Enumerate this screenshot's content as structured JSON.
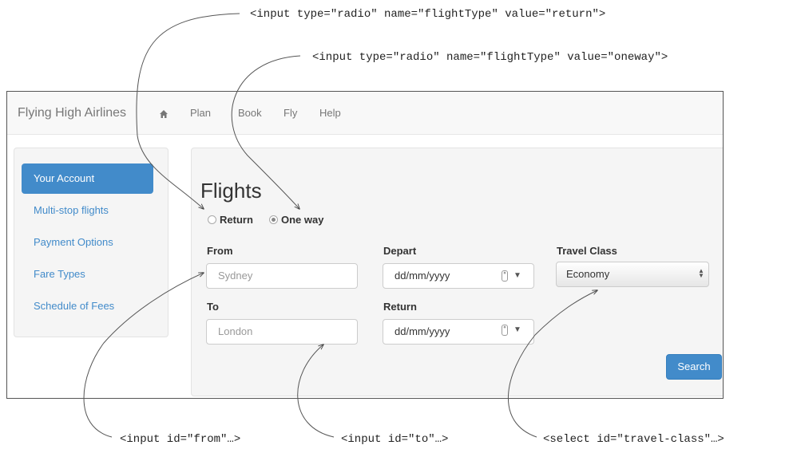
{
  "annotations": {
    "return_radio": "<input type=\"radio\" name=\"flightType\" value=\"return\">",
    "oneway_radio": "<input type=\"radio\" name=\"flightType\" value=\"oneway\">",
    "from_input": "<input id=\"from\"…>",
    "to_input": "<input id=\"to\"…>",
    "travel_class_select": "<select id=\"travel-class\"…>"
  },
  "navbar": {
    "brand": "Flying High Airlines",
    "links": [
      "Plan",
      "Book",
      "Fly",
      "Help"
    ]
  },
  "sidebar": {
    "items": [
      {
        "label": "Your Account",
        "active": true
      },
      {
        "label": "Multi-stop flights"
      },
      {
        "label": "Payment Options"
      },
      {
        "label": "Fare Types"
      },
      {
        "label": "Schedule of Fees"
      }
    ]
  },
  "form": {
    "title": "Flights",
    "flight_type": {
      "return_label": "Return",
      "oneway_label": "One way",
      "selected": "oneway"
    },
    "from": {
      "label": "From",
      "placeholder": "Sydney"
    },
    "to": {
      "label": "To",
      "placeholder": "London"
    },
    "depart": {
      "label": "Depart",
      "placeholder": "dd/mm/yyyy"
    },
    "return": {
      "label": "Return",
      "placeholder": "dd/mm/yyyy"
    },
    "travel_class": {
      "label": "Travel Class",
      "value": "Economy"
    },
    "search_label": "Search"
  },
  "colors": {
    "accent": "#428bca",
    "navbar_bg": "#f8f8f8",
    "panel_bg": "#f5f5f5"
  }
}
